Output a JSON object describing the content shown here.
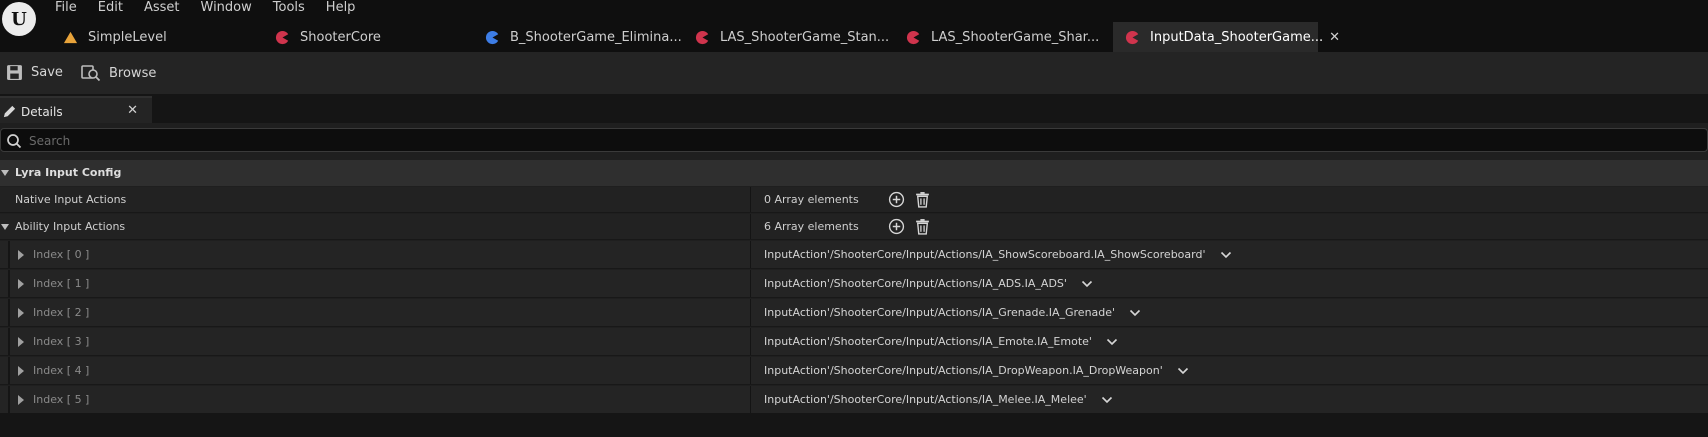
{
  "menu": {
    "items": [
      "File",
      "Edit",
      "Asset",
      "Window",
      "Tools",
      "Help"
    ]
  },
  "tabs": [
    {
      "label": "SimpleLevel",
      "icon": "level-icon",
      "color": "#e8a33a"
    },
    {
      "label": "ShooterCore",
      "icon": "plugin-icon",
      "color": "#d0344d"
    },
    {
      "label": "B_ShooterGame_Elimina...",
      "icon": "blueprint-icon",
      "color": "#3d7de6"
    },
    {
      "label": "LAS_ShooterGame_Stan...",
      "icon": "data-asset-icon",
      "color": "#d0344d"
    },
    {
      "label": "LAS_ShooterGame_Shar...",
      "icon": "data-asset-icon",
      "color": "#d0344d"
    },
    {
      "label": "InputData_ShooterGame...",
      "icon": "data-asset-icon",
      "color": "#d0344d",
      "active": true
    }
  ],
  "toolbar": {
    "save_label": "Save",
    "browse_label": "Browse"
  },
  "details": {
    "tab_label": "Details",
    "search_placeholder": "Search",
    "category": "Lyra Input Config",
    "native": {
      "label": "Native Input Actions",
      "value": "0 Array elements"
    },
    "ability": {
      "label": "Ability Input Actions",
      "value": "6 Array elements"
    },
    "elements": [
      {
        "index": "Index [ 0 ]",
        "value": "InputAction'/ShooterCore/Input/Actions/IA_ShowScoreboard.IA_ShowScoreboard'"
      },
      {
        "index": "Index [ 1 ]",
        "value": "InputAction'/ShooterCore/Input/Actions/IA_ADS.IA_ADS'"
      },
      {
        "index": "Index [ 2 ]",
        "value": "InputAction'/ShooterCore/Input/Actions/IA_Grenade.IA_Grenade'"
      },
      {
        "index": "Index [ 3 ]",
        "value": "InputAction'/ShooterCore/Input/Actions/IA_Emote.IA_Emote'"
      },
      {
        "index": "Index [ 4 ]",
        "value": "InputAction'/ShooterCore/Input/Actions/IA_DropWeapon.IA_DropWeapon'"
      },
      {
        "index": "Index [ 5 ]",
        "value": "InputAction'/ShooterCore/Input/Actions/IA_Melee.IA_Melee'"
      }
    ]
  }
}
